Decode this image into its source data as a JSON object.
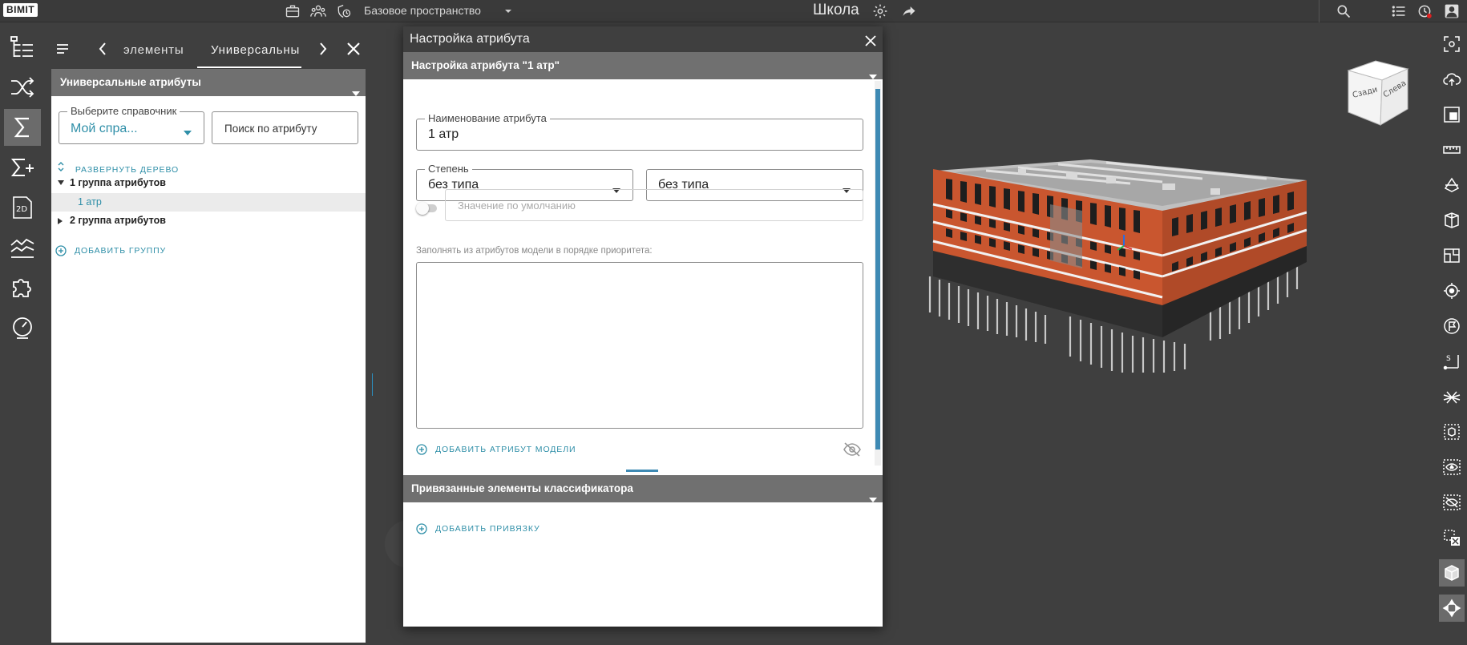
{
  "app": {
    "logo_text": "BIMIT",
    "space_name": "Базовое пространство",
    "project_title": "Школа"
  },
  "left_panel": {
    "tabs": [
      {
        "label": "элементы"
      },
      {
        "label": "Универсальны"
      }
    ],
    "header": "Универсальные атрибуты",
    "directory": {
      "legend": "Выберите справочник",
      "value": "Мой спра..."
    },
    "search": {
      "placeholder": "Поиск по атрибуту"
    },
    "expand_tree_label": "РАЗВЕРНУТЬ ДЕРЕВО",
    "tree": {
      "group1": "1 группа атрибутов",
      "group1_item": "1 атр",
      "group2": "2 группа атрибутов"
    },
    "add_group_label": "ДОБАВИТЬ ГРУППУ"
  },
  "dialog": {
    "title": "Настройка атрибута",
    "section1_title": "Настройка атрибута \"1 атр\"",
    "name_field": {
      "legend": "Наименование атрибута",
      "value": "1 атр"
    },
    "degree_field": {
      "legend": "Степень",
      "value": "без типа"
    },
    "type_field": {
      "value": "без типа"
    },
    "default_value": {
      "placeholder": "Значение по умолчанию",
      "enabled": false
    },
    "fill_label": "Заполнять из атрибутов модели в порядке приоритета:",
    "add_model_attr_label": "ДОБАВИТЬ АТРИБУТ МОДЕЛИ",
    "section2_title": "Привязанные элементы классификатора",
    "add_link_label": "ДОБАВИТЬ ПРИВЯЗКУ"
  },
  "viewcube": {
    "left_face": "Сзади",
    "right_face": "Слева"
  },
  "help_label": "?",
  "colors": {
    "accent": "#2f8fa8",
    "scrollbar": "#3e8ab4",
    "header_bg": "#707070",
    "bg": "#3f3f3f",
    "facade": "#c9562f"
  }
}
